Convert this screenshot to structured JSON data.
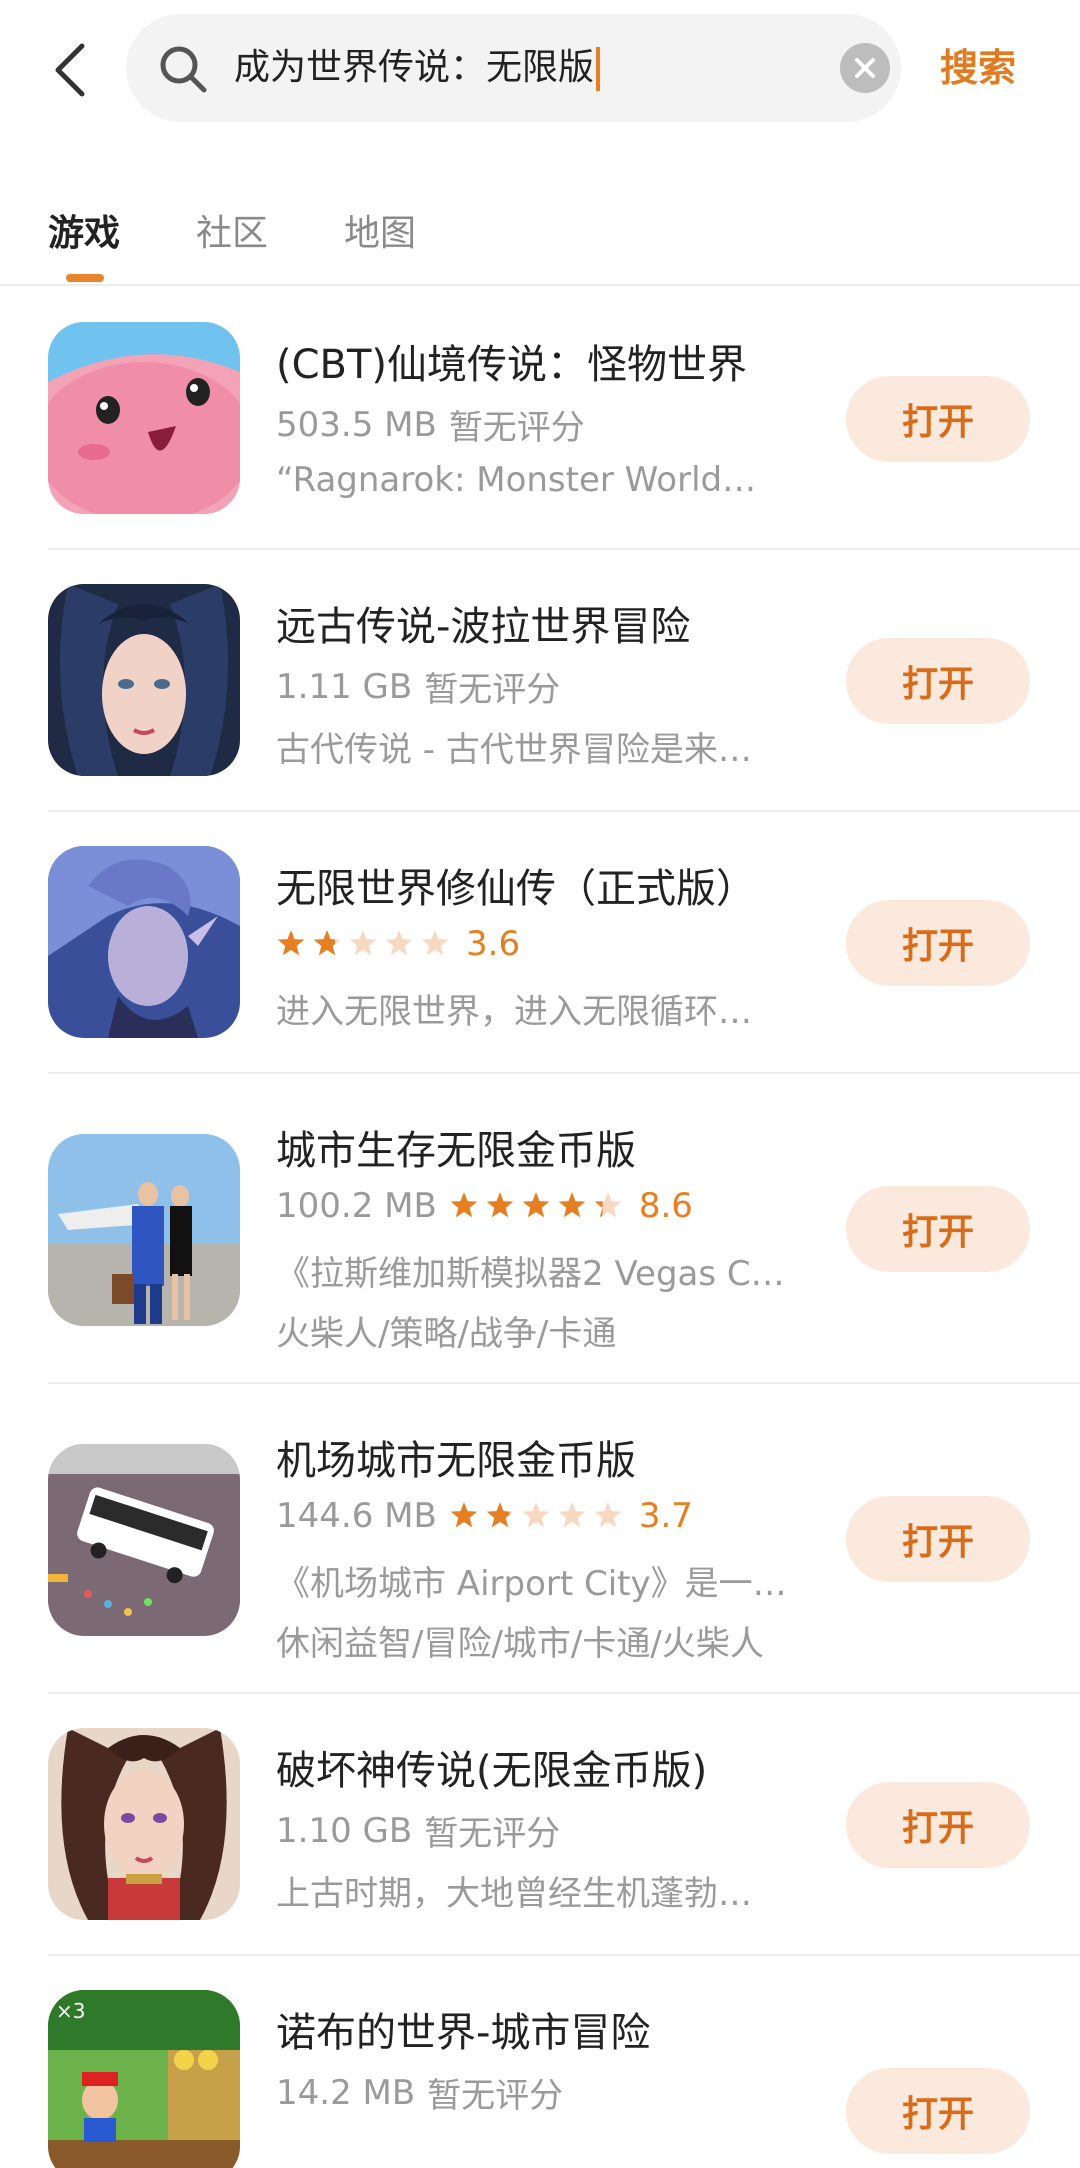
{
  "header": {
    "search_text": "成为世界传说：无限版",
    "search_button": "搜索"
  },
  "tabs": [
    {
      "label": "游戏",
      "active": true
    },
    {
      "label": "社区",
      "active": false
    },
    {
      "label": "地图",
      "active": false
    }
  ],
  "results": [
    {
      "title": "(CBT)仙境传说：怪物世界",
      "size": "503.5 MB",
      "rating_text": "暂无评分",
      "rating": null,
      "desc": "“Ragnarok: Monster World…",
      "tags": "",
      "button": "打开"
    },
    {
      "title": "远古传说-波拉世界冒险",
      "size": "1.11 GB",
      "rating_text": "暂无评分",
      "rating": null,
      "desc": "古代传说 - 古代世界冒险是来…",
      "tags": "",
      "button": "打开"
    },
    {
      "title": "无限世界修仙传（正式版）",
      "size": "",
      "rating_text": "3.6",
      "rating": 3.6,
      "desc": "进入无限世界，进入无限循环…",
      "tags": "",
      "button": "打开"
    },
    {
      "title": "城市生存无限金币版",
      "size": "100.2 MB",
      "rating_text": "8.6",
      "rating": 8.6,
      "desc": "《拉斯维加斯模拟器2 Vegas C…",
      "tags": "火柴人/策略/战争/卡通",
      "button": "打开"
    },
    {
      "title": "机场城市无限金币版",
      "size": "144.6 MB",
      "rating_text": "3.7",
      "rating": 3.7,
      "desc": "《机场城市 Airport City》是一…",
      "tags": "休闲益智/冒险/城市/卡通/火柴人",
      "button": "打开"
    },
    {
      "title": "破坏神传说(无限金币版)",
      "size": "1.10 GB",
      "rating_text": "暂无评分",
      "rating": null,
      "desc": "上古时期，大地曾经生机蓬勃…",
      "tags": "",
      "button": "打开"
    },
    {
      "title": "诺布的世界-城市冒险",
      "size": "14.2 MB",
      "rating_text": "暂无评分",
      "rating": null,
      "desc": "",
      "tags": "",
      "button": "打开"
    }
  ],
  "colors": {
    "accent": "#e67e22",
    "button_bg": "#fce9dd"
  }
}
